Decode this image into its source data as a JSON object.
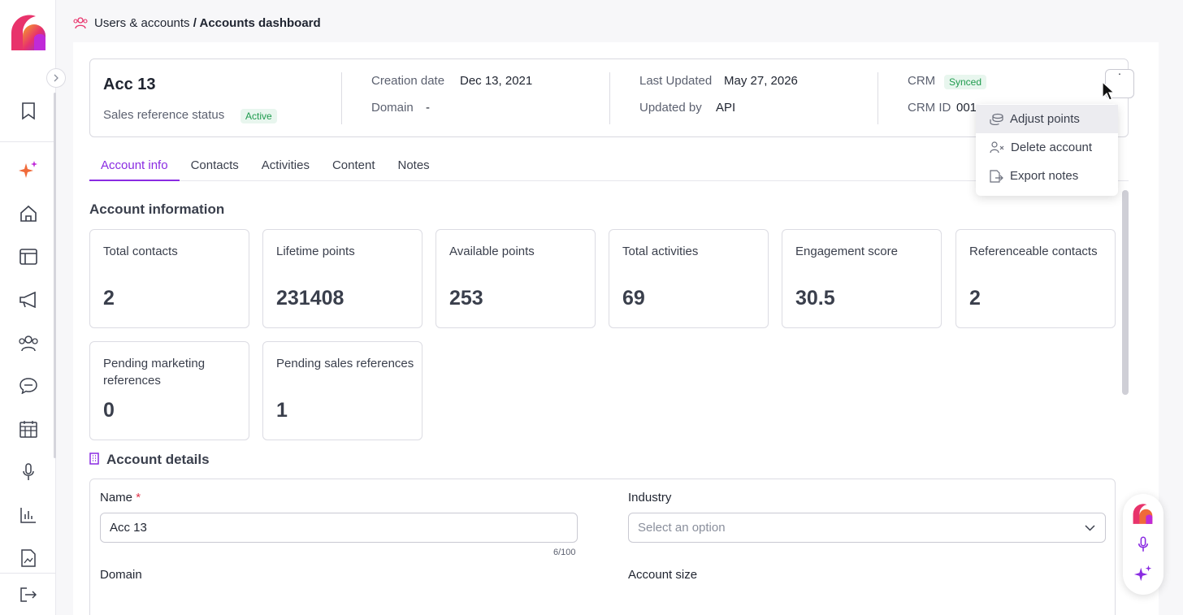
{
  "breadcrumb": {
    "parent": "Users & accounts",
    "separator": " / ",
    "current": "Accounts dashboard"
  },
  "account": {
    "name": "Acc 13",
    "sales_status_label": "Sales reference status",
    "sales_status": "Active",
    "creation_date_label": "Creation date",
    "creation_date": "Dec 13, 2021",
    "domain_label": "Domain",
    "domain": "-",
    "last_updated_label": "Last Updated",
    "last_updated": "May 27, 2026",
    "updated_by_label": "Updated by",
    "updated_by": "API",
    "crm_label": "CRM",
    "crm_status": "Synced",
    "crm_id_label": "CRM ID",
    "crm_id": "001."
  },
  "tabs": [
    "Account info",
    "Contacts",
    "Activities",
    "Content",
    "Notes"
  ],
  "account_information": {
    "title": "Account information",
    "stats": [
      {
        "label": "Total contacts",
        "value": "2"
      },
      {
        "label": "Lifetime points",
        "value": "231408"
      },
      {
        "label": "Available points",
        "value": "253"
      },
      {
        "label": "Total activities",
        "value": "69"
      },
      {
        "label": "Engagement score",
        "value": "30.5"
      },
      {
        "label": "Referenceable contacts",
        "value": "2"
      },
      {
        "label": "Pending marketing references",
        "value": "0"
      },
      {
        "label": "Pending sales references",
        "value": "1"
      }
    ]
  },
  "account_details": {
    "title": "Account details",
    "name_label": "Name",
    "required_mark": "*",
    "name_value": "Acc 13",
    "name_counter": "6/100",
    "industry_label": "Industry",
    "industry_placeholder": "Select an option",
    "domain_label": "Domain",
    "account_size_label": "Account size"
  },
  "menu": {
    "items": [
      "Adjust points",
      "Delete account",
      "Export notes"
    ]
  },
  "colors": {
    "accent": "#8a2be2",
    "success": "#1f9b4e",
    "success_bg": "#e8f6ee"
  }
}
